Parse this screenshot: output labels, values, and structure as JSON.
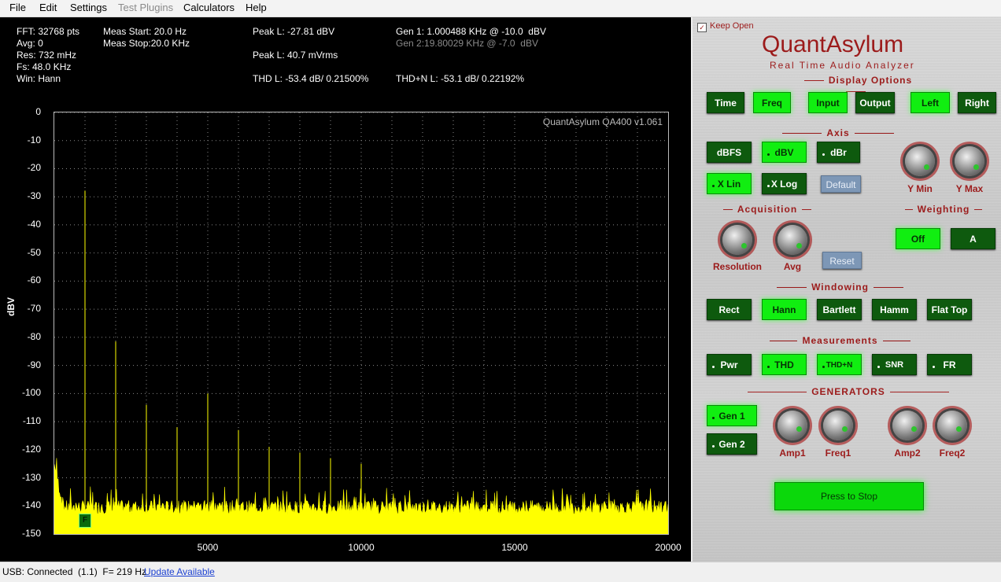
{
  "menu": [
    "File",
    "Edit",
    "Settings",
    "Test Plugins",
    "Calculators",
    "Help"
  ],
  "readouts": {
    "fft": "FFT: 32768 pts",
    "avg": "Avg: 0",
    "res": "Res: 732 mHz",
    "fs": "Fs: 48.0 KHz",
    "win": "Win: Hann",
    "meas_start": "Meas Start: 20.0 Hz",
    "meas_stop": "Meas Stop:20.0 KHz",
    "peak_l_dbv": "Peak L: -27.81 dBV",
    "peak_l_mvrms": "Peak L: 40.7 mVrms",
    "thd_l": "THD L: -53.4 dB/ 0.21500%",
    "gen1": "Gen 1: 1.000488 KHz @ -10.0  dBV",
    "gen2": "Gen 2:19.80029 KHz @ -7.0  dBV",
    "thdn_l": "THD+N L: -53.1 dB/ 0.22192%"
  },
  "chart_data": {
    "type": "line",
    "ylabel": "dBV",
    "xlim": [
      0,
      20000
    ],
    "ylim": [
      -150,
      0
    ],
    "yticks": [
      0,
      -10,
      -20,
      -30,
      -40,
      -50,
      -60,
      -70,
      -80,
      -90,
      -100,
      -110,
      -120,
      -130,
      -140,
      -150
    ],
    "xticks": [
      5000,
      10000,
      15000,
      20000
    ],
    "watermark": "QuantAsylum QA400 v1.061",
    "grid": true,
    "noise_floor_db": -140,
    "series_color": "#ffff00",
    "peaks": [
      {
        "x": 1000,
        "y": -27.8
      },
      {
        "x": 2000,
        "y": -81.5
      },
      {
        "x": 3000,
        "y": -104
      },
      {
        "x": 4000,
        "y": -112
      },
      {
        "x": 5000,
        "y": -100
      },
      {
        "x": 6000,
        "y": -113
      },
      {
        "x": 7000,
        "y": -119
      },
      {
        "x": 8000,
        "y": -121
      },
      {
        "x": 9000,
        "y": -123
      },
      {
        "x": 10000,
        "y": -125
      }
    ],
    "marker_label": "F"
  },
  "panel": {
    "keep_open": "Keep Open",
    "brand": "QuantAsylum",
    "brand_sub": "Real Time Audio Analyzer",
    "sections": {
      "display": "Display Options",
      "axis": "Axis",
      "acquisition": "Acquisition",
      "weighting": "Weighting",
      "windowing": "Windowing",
      "measurements": "Measurements",
      "generators": "GENERATORS"
    },
    "display_buttons": [
      "Time",
      "Freq",
      "Input",
      "Output",
      "Left",
      "Right"
    ],
    "axis_buttons": [
      "dBFS",
      "dBV",
      "dBr",
      "X Lin",
      "X Log",
      "Default"
    ],
    "axis_knobs": [
      "Y Min",
      "Y Max"
    ],
    "acq_knobs": [
      "Resolution",
      "Avg"
    ],
    "reset": "Reset",
    "weighting_buttons": [
      "Off",
      "A"
    ],
    "window_buttons": [
      "Rect",
      "Hann",
      "Bartlett",
      "Hamm",
      "Flat Top"
    ],
    "measure_buttons": [
      "Pwr",
      "THD",
      "THD+N",
      "SNR",
      "FR"
    ],
    "gen_buttons": [
      "Gen 1",
      "Gen 2"
    ],
    "gen_knobs": [
      "Amp1",
      "Freq1",
      "Amp2",
      "Freq2"
    ],
    "stop": "Press to Stop"
  },
  "status": {
    "usb": "USB: Connected  (1.1)  F= 219 Hz",
    "update": "Update Available"
  }
}
